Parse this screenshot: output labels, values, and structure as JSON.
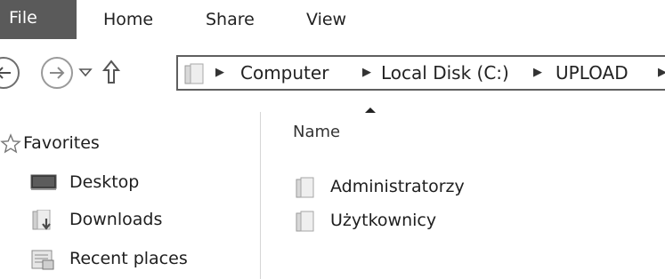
{
  "ribbon": {
    "tabs": [
      {
        "label": "File"
      },
      {
        "label": "Home"
      },
      {
        "label": "Share"
      },
      {
        "label": "View"
      }
    ]
  },
  "address_bar": {
    "breadcrumbs": [
      "Computer",
      "Local Disk (C:)",
      "UPLOAD"
    ]
  },
  "nav_pane": {
    "favorites_label": "Favorites",
    "items": [
      {
        "label": "Desktop",
        "icon": "desktop-icon"
      },
      {
        "label": "Downloads",
        "icon": "downloads-icon"
      },
      {
        "label": "Recent places",
        "icon": "recent-places-icon"
      }
    ]
  },
  "content": {
    "column_header": "Name",
    "rows": [
      {
        "name": "Administratorzy",
        "icon": "folder-icon"
      },
      {
        "name": "Użytkownicy",
        "icon": "folder-icon"
      }
    ]
  },
  "colors": {
    "file_tab_bg": "#5a5a5a",
    "border": "#5f5f5f"
  }
}
